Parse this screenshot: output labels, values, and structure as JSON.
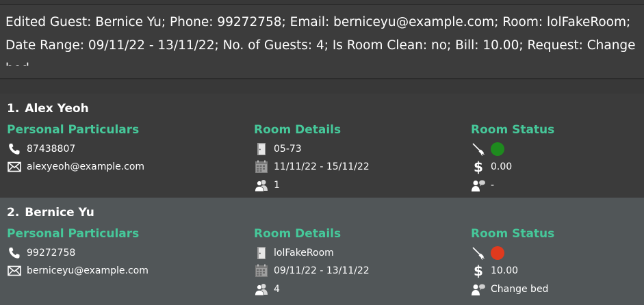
{
  "result": {
    "message": "Edited Guest: Bernice Yu; Phone: 99272758; Email: berniceyu@example.com; Room: lolFakeRoom; Date Range: 09/11/22 - 13/11/22; No. of Guests: 4; Is Room Clean: no; Bill: 10.00; Request: Change bed."
  },
  "labels": {
    "personal": "Personal Particulars",
    "room": "Room Details",
    "status": "Room Status"
  },
  "colors": {
    "accent": "#46c89a",
    "clean": "#1e8a1e",
    "dirty": "#e03a1e"
  },
  "guests": [
    {
      "index": "1.",
      "name": "Alex Yeoh",
      "phone": "87438807",
      "email": "alexyeoh@example.com",
      "room": "05-73",
      "date_range": "11/11/22 - 15/11/22",
      "num_guests": "1",
      "is_clean": true,
      "bill": "0.00",
      "request": "-"
    },
    {
      "index": "2.",
      "name": "Bernice Yu",
      "phone": "99272758",
      "email": "berniceyu@example.com",
      "room": "lolFakeRoom",
      "date_range": "09/11/22 - 13/11/22",
      "num_guests": "4",
      "is_clean": false,
      "bill": "10.00",
      "request": "Change bed"
    }
  ]
}
